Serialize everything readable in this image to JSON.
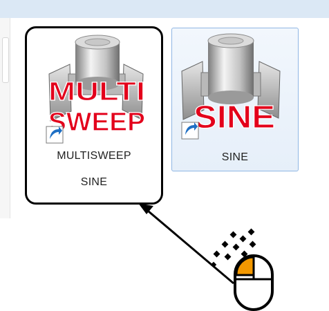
{
  "files": [
    {
      "label_line1": "MULTISWEEP",
      "label_line2": "SINE",
      "icon_text_top": "MULTI",
      "icon_text_bottom": "SWEEP",
      "icon": "multisweep-sine-app-icon",
      "shortcut_icon": "shortcut-arrow-icon",
      "highlighted": true
    },
    {
      "label_line1": "SINE",
      "icon_text": "SINE",
      "icon": "sine-app-icon",
      "shortcut_icon": "shortcut-arrow-icon",
      "selected": true
    }
  ],
  "annotation": {
    "pointer": "arrow-annotation",
    "mouse_icon": "mouse-double-click-icon"
  },
  "colors": {
    "icon_text": "#e3001b",
    "selection_border": "#8fb6e4",
    "mouse_button": "#f39800",
    "window_bar": "#dbe8f5"
  }
}
